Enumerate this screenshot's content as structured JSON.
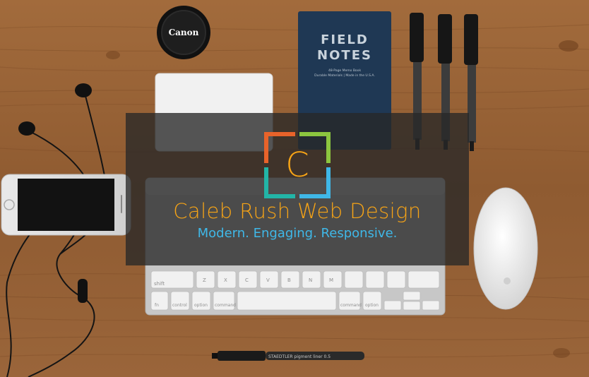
{
  "hero": {
    "brand_name": "Caleb Rush Web Design",
    "tagline": "Modern. Engaging. Responsive.",
    "logo_letter": "C",
    "colors": {
      "brand_orange": "#f7a416",
      "tagline_blue": "#3fb8e8",
      "logo_orange": "#e8632a",
      "logo_green": "#8cc63f",
      "logo_blue": "#3fb8e8",
      "logo_teal": "#22b5a7"
    }
  },
  "photo": {
    "lens_cap_text": "Canon",
    "notebook_title_line1": "FIELD",
    "notebook_title_line2": "NOTES",
    "notebook_subtitle_line1": "48-Page Memo Book",
    "notebook_subtitle_line2": "Durable Materials | Made in the U.S.A.",
    "pen_text": "STAEDTLER pigment liner 0.5",
    "keyboard_keys": {
      "shift": "shift",
      "fn": "fn",
      "control": "control",
      "option": "option",
      "command": "command",
      "z": "Z",
      "x": "X",
      "c": "C",
      "v": "V",
      "b": "B",
      "n": "N",
      "m": "M"
    }
  }
}
